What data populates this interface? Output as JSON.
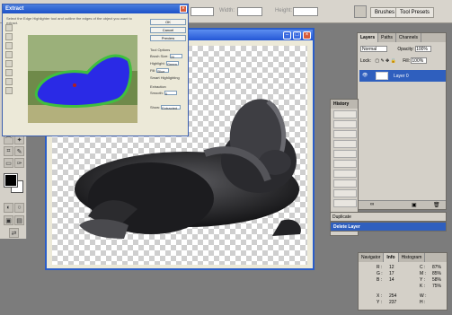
{
  "options_bar": {
    "width_label": "Width:",
    "height_label": "Height:",
    "tab_brushes": "Brushes",
    "tab_tool_presets": "Tool Presets"
  },
  "extract_dialog": {
    "title": "Extract",
    "instructions": "Select the Edge Highlighter tool and outline the edges of the object you want to extract.",
    "ok_label": "OK",
    "cancel_label": "Cancel",
    "preview_label": "Preview",
    "tool_options_label": "Tool Options",
    "brush_size_label": "Brush Size:",
    "brush_size_value": "20",
    "highlight_label": "Highlight:",
    "highlight_value": "Green",
    "fill_label": "Fill:",
    "fill_value": "Blue",
    "smart_highlighting_label": "Smart Highlighting",
    "extraction_label": "Extraction",
    "smooth_label": "Smooth:",
    "smooth_value": "0",
    "show_label": "Show:",
    "show_value": "Extracted"
  },
  "document": {
    "title": "Untitled-1 @ 66.7% (Layer 0, RGB/8)"
  },
  "layers_panel": {
    "tabs": [
      "Layers",
      "Paths",
      "Channels"
    ],
    "blend_mode": "Normal",
    "opacity_label": "Opacity:",
    "opacity_value": "100%",
    "lock_label": "Lock:",
    "fill_label": "Fill:",
    "fill_value": "100%",
    "layer_name": "Layer 0"
  },
  "history_panel": {
    "title": "History",
    "duplicate_label": "Duplicate",
    "delete_layer_label": "Delete Layer"
  },
  "info_panel": {
    "tabs": [
      "Navigator",
      "Info",
      "Histogram"
    ],
    "r_label": "R :",
    "r_value": "12",
    "g_label": "G :",
    "g_value": "17",
    "b_label": "B :",
    "b_value": "14",
    "c_label": "C :",
    "c_value": "87%",
    "m_label": "M :",
    "m_value": "85%",
    "y_label": "Y :",
    "y_value": "58%",
    "k_label": "K :",
    "k_value": "75%",
    "x_label": "X :",
    "x_value": "254",
    "yy_label": "Y :",
    "yy_value": "237",
    "w_label": "W :",
    "h_label": "H :"
  },
  "colors": {
    "foreground": "#000000",
    "background": "#ffffff",
    "highlight_green": "#3fbf3f",
    "fill_blue": "#2a2ae6",
    "selection_blue": "#2f5fbe"
  }
}
